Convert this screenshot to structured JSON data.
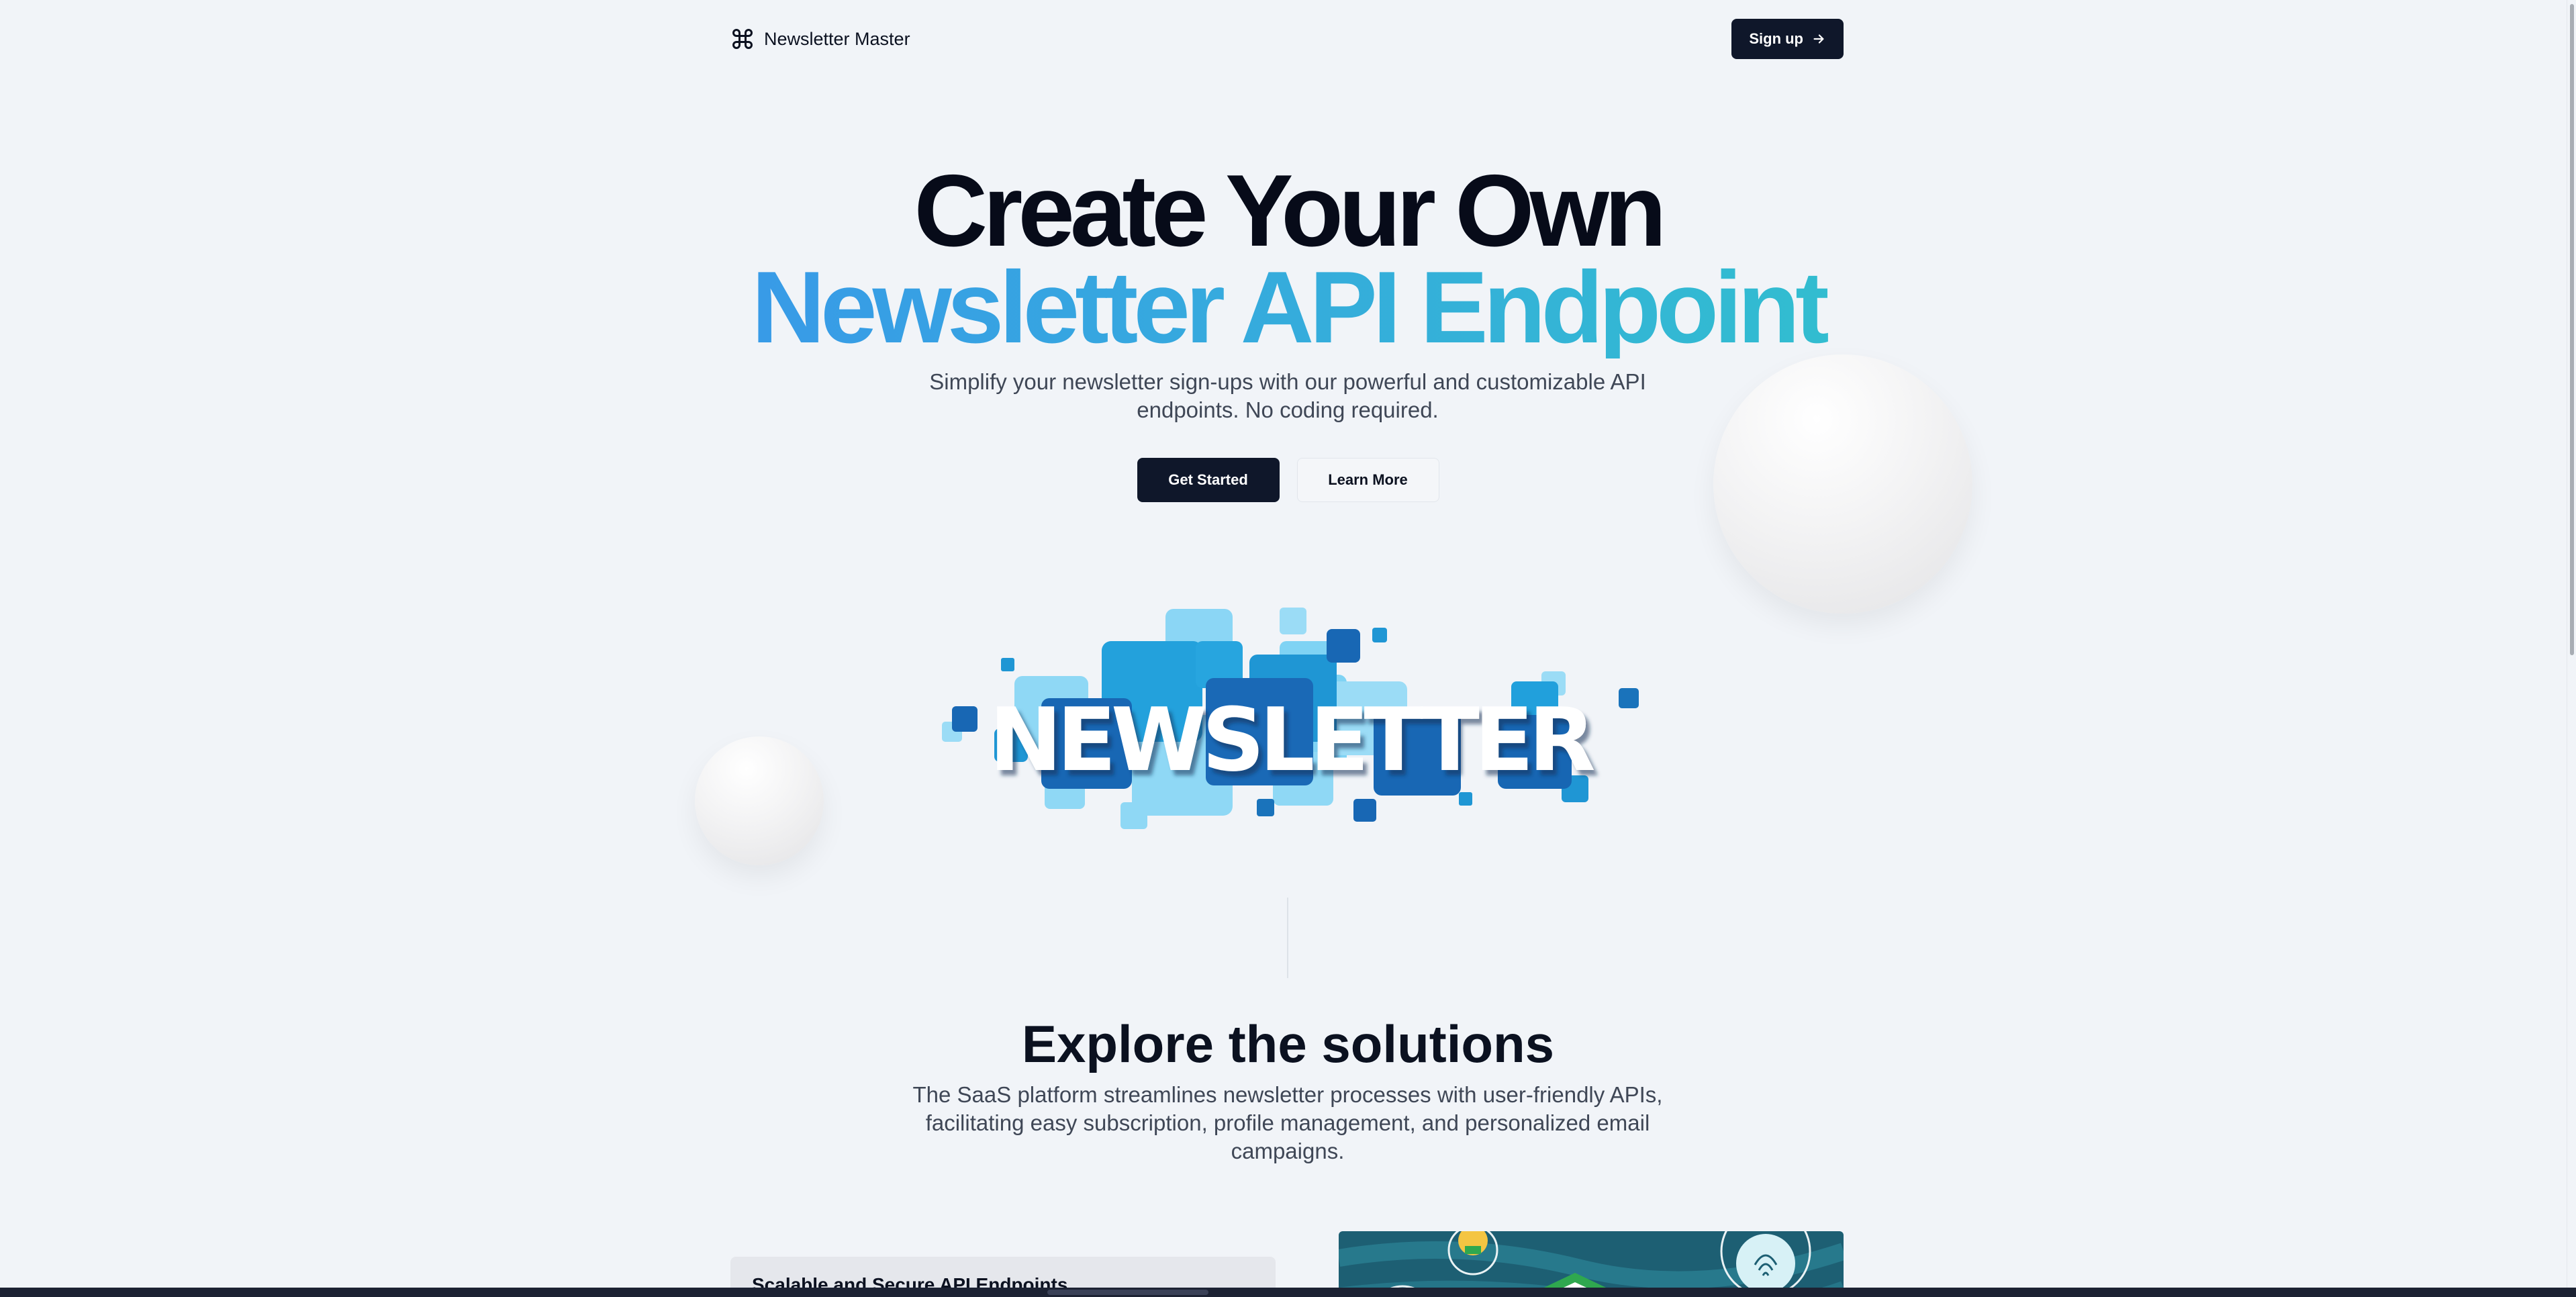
{
  "header": {
    "brand_name": "Newsletter Master",
    "brand_icon": "command-icon",
    "signup_label": "Sign up",
    "signup_icon": "arrow-right-icon"
  },
  "hero": {
    "title_line1": "Create Your Own",
    "title_line2": "Newsletter API Endpoint",
    "subtitle": "Simplify your newsletter sign-ups with our powerful and customizable API endpoints. No coding required.",
    "primary_cta": "Get Started",
    "secondary_cta": "Learn More",
    "illustration_text": "NEWSLETTER"
  },
  "solutions": {
    "title": "Explore the solutions",
    "subtitle": "The SaaS platform streamlines newsletter processes with user-friendly APIs, facilitating easy subscription, profile management, and personalized email campaigns.",
    "feature_card_title": "Scalable and Secure API Endpoints"
  },
  "colors": {
    "background": "#f1f4f8",
    "dark": "#0f172a",
    "gradient_start": "#3b82f6",
    "gradient_end": "#2dd4bf"
  }
}
